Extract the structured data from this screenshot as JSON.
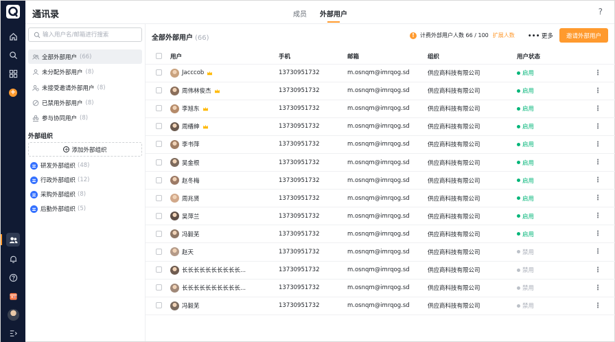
{
  "app": {
    "title": "通讯录",
    "help_icon": "question-icon"
  },
  "tabs": [
    {
      "label": "成员"
    },
    {
      "label": "外部用户"
    }
  ],
  "sidebar": {
    "search_placeholder": "输入用户名/邮箱进行搜索",
    "items": [
      {
        "label": "全部外部用户",
        "count": "(66)",
        "icon": "users-icon"
      },
      {
        "label": "未分配外部用户",
        "count": "(8)",
        "icon": "user-icon"
      },
      {
        "label": "未接受邀请外部用户",
        "count": "(8)",
        "icon": "user-clock-icon"
      },
      {
        "label": "已禁用外部用户",
        "count": "(8)",
        "icon": "ban-icon"
      },
      {
        "label": "参与协同用户",
        "count": "(8)",
        "icon": "users-icon"
      }
    ],
    "section_title": "外部组织",
    "add_org_label": "添加外部组织",
    "orgs": [
      {
        "label": "研发外部组织",
        "count": "(48)"
      },
      {
        "label": "行政外部组织",
        "count": "(12)"
      },
      {
        "label": "采购外部组织",
        "count": "(8)"
      },
      {
        "label": "后勤外部组织",
        "count": "(5)"
      }
    ]
  },
  "main": {
    "title": "全部外部用户",
    "count": "(66)",
    "billing_text": "计费外部用户人数 66 / 100",
    "expand_label": "扩展人数",
    "more_label": "更多",
    "invite_label": "邀请外部用户",
    "columns": [
      "用户",
      "手机",
      "邮箱",
      "组织",
      "用户状态"
    ],
    "rows": [
      {
        "name": "Jacccob",
        "crown": true,
        "phone": "13730951732",
        "email": "m.osnqm@imrqog.sd",
        "org": "供应商科技有限公司",
        "status": "启用",
        "active": true
      },
      {
        "name": "周伟林俊杰",
        "crown": true,
        "phone": "13730951732",
        "email": "m.osnqm@imrqog.sd",
        "org": "供应商科技有限公司",
        "status": "启用",
        "active": true
      },
      {
        "name": "李旭东",
        "crown": true,
        "phone": "13730951732",
        "email": "m.osnqm@imrqog.sd",
        "org": "供应商科技有限公司",
        "status": "启用",
        "active": true
      },
      {
        "name": "周缙绅",
        "crown": true,
        "phone": "13730951732",
        "email": "m.osnqm@imrqog.sd",
        "org": "供应商科技有限公司",
        "status": "启用",
        "active": true
      },
      {
        "name": "李书萍",
        "crown": false,
        "phone": "13730951732",
        "email": "m.osnqm@imrqog.sd",
        "org": "供应商科技有限公司",
        "status": "启用",
        "active": true
      },
      {
        "name": "吴金根",
        "crown": false,
        "phone": "13730951732",
        "email": "m.osnqm@imrqog.sd",
        "org": "供应商科技有限公司",
        "status": "启用",
        "active": true
      },
      {
        "name": "赵冬梅",
        "crown": false,
        "phone": "13730951732",
        "email": "m.osnqm@imrqog.sd",
        "org": "供应商科技有限公司",
        "status": "启用",
        "active": true
      },
      {
        "name": "周兆贤",
        "crown": false,
        "phone": "13730951732",
        "email": "m.osnqm@imrqog.sd",
        "org": "供应商科技有限公司",
        "status": "启用",
        "active": true
      },
      {
        "name": "吴萍兰",
        "crown": false,
        "phone": "13730951732",
        "email": "m.osnqm@imrqog.sd",
        "org": "供应商科技有限公司",
        "status": "启用",
        "active": true
      },
      {
        "name": "冯毅芜",
        "crown": false,
        "phone": "13730951732",
        "email": "m.osnqm@imrqog.sd",
        "org": "供应商科技有限公司",
        "status": "启用",
        "active": true
      },
      {
        "name": "赵天",
        "crown": false,
        "phone": "13730951732",
        "email": "m.osnqm@imrqog.sd",
        "org": "供应商科技有限公司",
        "status": "禁用",
        "active": false
      },
      {
        "name": "长长长长长长长长长长...",
        "crown": false,
        "phone": "13730951732",
        "email": "m.osnqm@imrqog.sd",
        "org": "供应商科技有限公司",
        "status": "禁用",
        "active": false
      },
      {
        "name": "长长长长长长长长长长...",
        "crown": false,
        "phone": "13730951732",
        "email": "m.osnqm@imrqog.sd",
        "org": "供应商科技有限公司",
        "status": "禁用",
        "active": false
      },
      {
        "name": "冯毅芜",
        "crown": false,
        "phone": "13730951732",
        "email": "m.osnqm@imrqog.sd",
        "org": "供应商科技有限公司",
        "status": "禁用",
        "active": false
      }
    ]
  },
  "colors": {
    "accent": "#ff9a2e",
    "rail": "#101a33",
    "enabled": "#00b578",
    "disabled": "#a9aeb8",
    "org_icon": "#3370ff"
  },
  "rail_icons": [
    "home-icon",
    "search-icon",
    "apps-icon",
    "add-icon",
    "contacts-icon",
    "bell-icon",
    "help-icon",
    "calendar-icon",
    "avatar",
    "collapse-icon"
  ]
}
